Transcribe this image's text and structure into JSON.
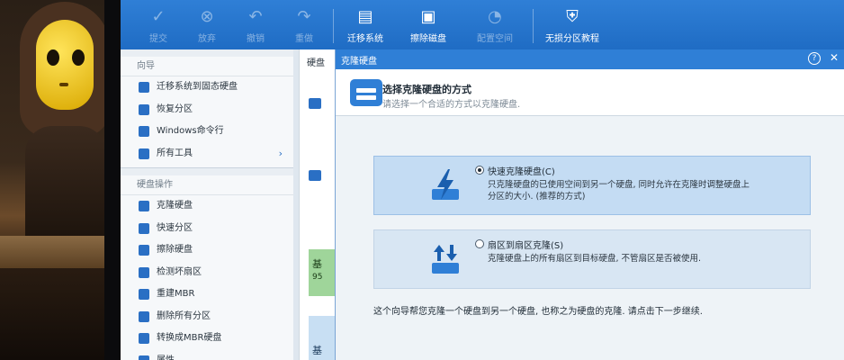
{
  "toolbar": {
    "items": [
      {
        "label": "提交",
        "icon": "check-icon",
        "enabled": false
      },
      {
        "label": "放弃",
        "icon": "cancel-icon",
        "enabled": false
      },
      {
        "label": "撤销",
        "icon": "undo-icon",
        "enabled": false
      },
      {
        "label": "重做",
        "icon": "redo-icon",
        "enabled": false
      },
      {
        "label": "迁移系统",
        "icon": "migrate-os-icon",
        "enabled": true
      },
      {
        "label": "擦除磁盘",
        "icon": "wipe-disk-icon",
        "enabled": true
      },
      {
        "label": "配置空间",
        "icon": "allocate-space-icon",
        "enabled": false
      },
      {
        "label": "无损分区教程",
        "icon": "shield-icon",
        "enabled": true
      }
    ]
  },
  "sidebar": {
    "wizard": {
      "title": "向导",
      "items": [
        {
          "label": "迁移系统到固态硬盘",
          "icon": "migrate-ssd-icon"
        },
        {
          "label": "恢复分区",
          "icon": "recover-partition-icon"
        },
        {
          "label": "Windows命令行",
          "icon": "windows-icon"
        },
        {
          "label": "所有工具",
          "icon": "more-icon",
          "chevron": "›"
        }
      ]
    },
    "disk_ops": {
      "title": "硬盘操作",
      "items": [
        {
          "label": "克隆硬盘",
          "icon": "clone-disk-icon"
        },
        {
          "label": "快速分区",
          "icon": "quick-partition-icon"
        },
        {
          "label": "擦除硬盘",
          "icon": "wipe-disk-icon"
        },
        {
          "label": "检测坏扇区",
          "icon": "bad-sector-icon"
        },
        {
          "label": "重建MBR",
          "icon": "rebuild-mbr-icon"
        },
        {
          "label": "删除所有分区",
          "icon": "delete-partitions-icon"
        },
        {
          "label": "转换成MBR硬盘",
          "icon": "convert-mbr-icon"
        },
        {
          "label": "属性",
          "icon": "properties-icon"
        }
      ]
    }
  },
  "middle": {
    "header": "硬盘",
    "green_text": "基",
    "green_num": "95",
    "blue_text": "基"
  },
  "dialog": {
    "title": "克隆硬盘",
    "help": "?",
    "close": "✕",
    "header_title": "选择克隆硬盘的方式",
    "header_subtitle": "请选择一个合适的方式以克隆硬盘.",
    "options": [
      {
        "title": "快速克隆硬盘(C)",
        "desc": "只克隆硬盘的已使用空间到另一个硬盘, 同时允许在克隆时调整硬盘上分区的大小. (推荐的方式)",
        "selected": true
      },
      {
        "title": "扇区到扇区克隆(S)",
        "desc": "克隆硬盘上的所有扇区到目标硬盘, 不管扇区是否被使用.",
        "selected": false
      }
    ],
    "footer": "这个向导帮您克隆一个硬盘到另一个硬盘, 也称之为硬盘的克隆. 请点击下一步继续."
  },
  "colors": {
    "accent": "#2f7fd6",
    "selected_option": "#c4dcf3"
  }
}
